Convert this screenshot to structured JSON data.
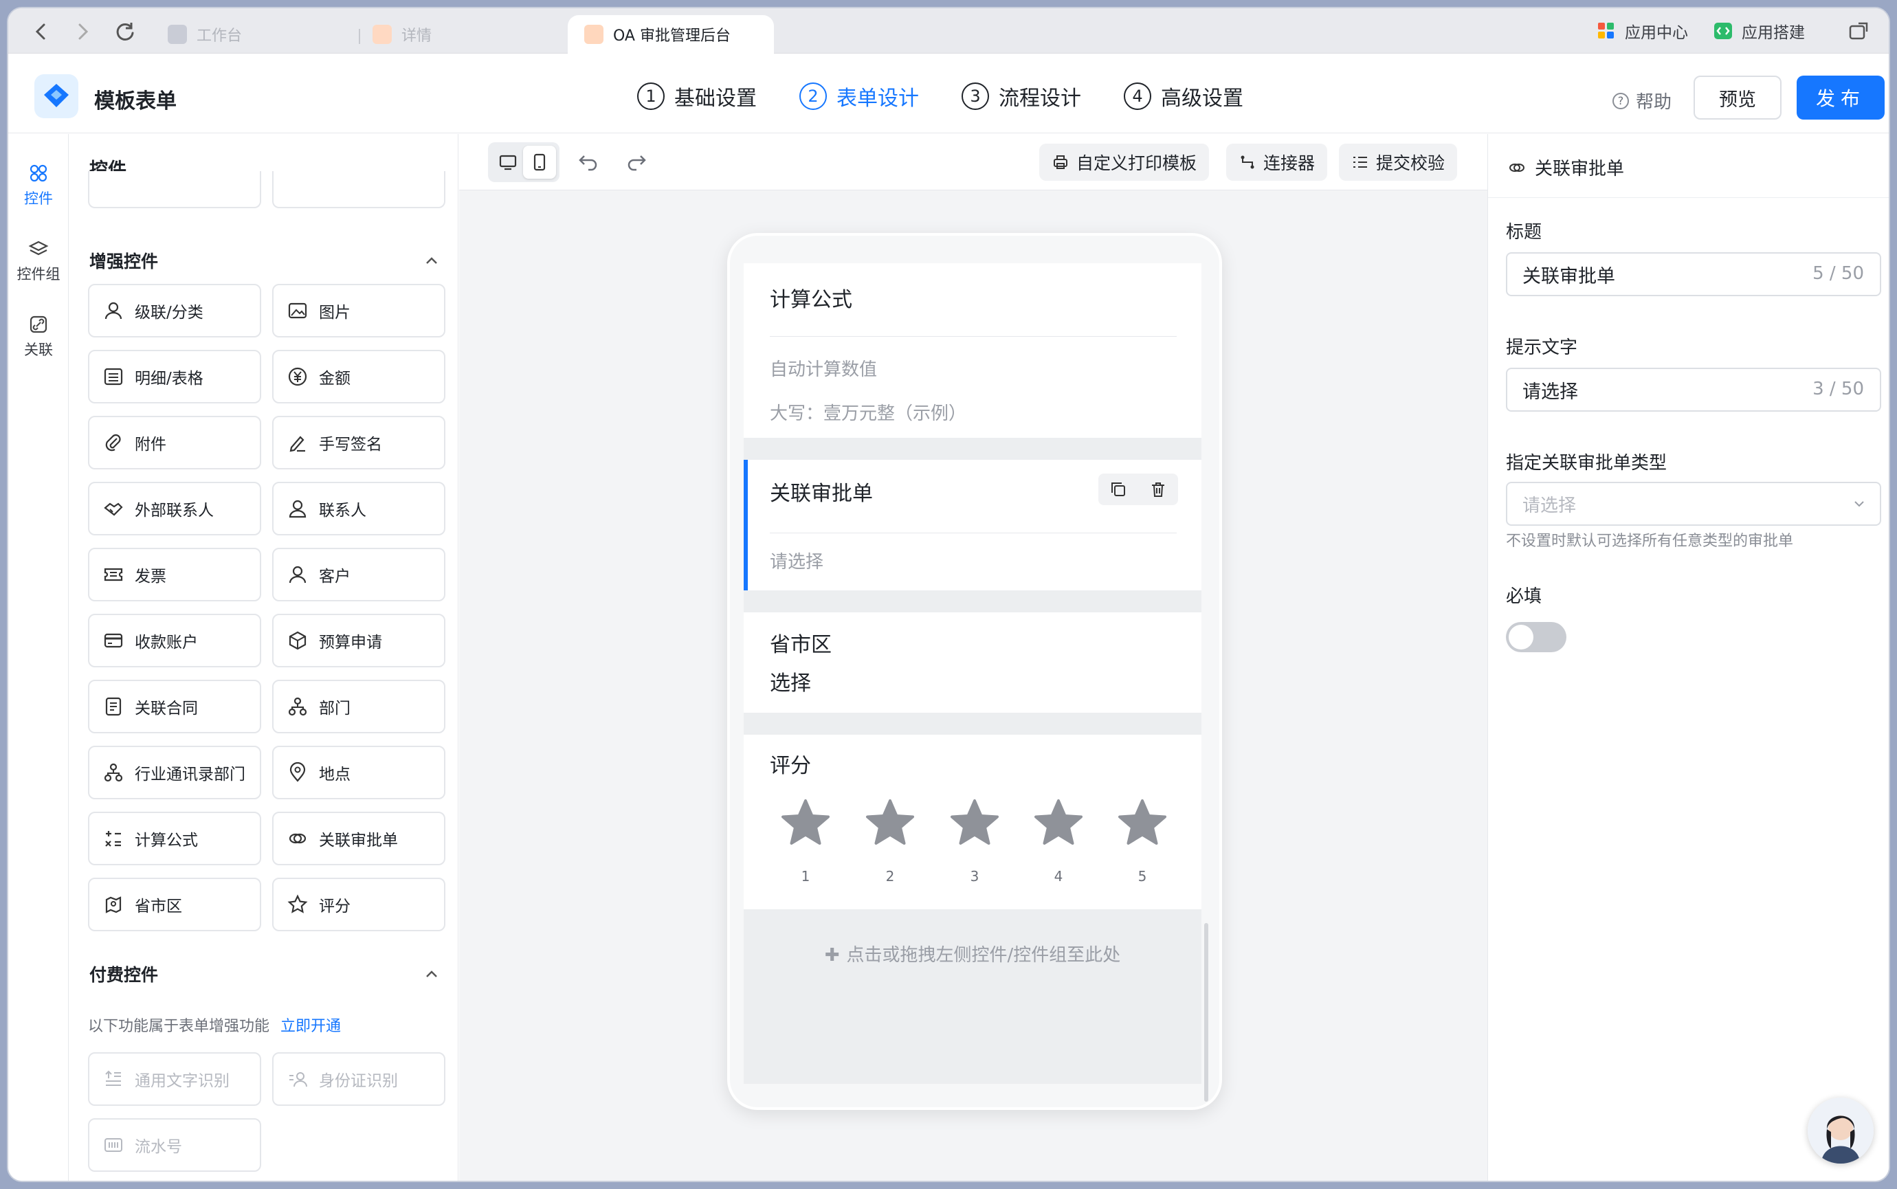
{
  "browser": {
    "tabs": [
      {
        "label": "工作台"
      },
      {
        "label": "详情"
      },
      {
        "label": "OA 审批管理后台"
      }
    ],
    "right": {
      "app_center": "应用中心",
      "app_builder": "应用搭建"
    }
  },
  "header": {
    "app_title": "模板表单",
    "steps": [
      {
        "num": "1",
        "label": "基础设置"
      },
      {
        "num": "2",
        "label": "表单设计"
      },
      {
        "num": "3",
        "label": "流程设计"
      },
      {
        "num": "4",
        "label": "高级设置"
      }
    ],
    "active_step": 2,
    "help": "帮助",
    "preview": "预览",
    "publish": "发布"
  },
  "rail": {
    "items": [
      {
        "label": "控件",
        "icon": "grid-icon"
      },
      {
        "label": "控件组",
        "icon": "layers-icon"
      },
      {
        "label": "关联",
        "icon": "link-icon"
      }
    ]
  },
  "panel": {
    "title": "控件",
    "enhanced_title": "增强控件",
    "enhanced": [
      {
        "label": "级联/分类",
        "icon": "user-icon"
      },
      {
        "label": "图片",
        "icon": "image-icon"
      },
      {
        "label": "明细/表格",
        "icon": "table-icon"
      },
      {
        "label": "金额",
        "icon": "yen-icon"
      },
      {
        "label": "附件",
        "icon": "paperclip-icon"
      },
      {
        "label": "手写签名",
        "icon": "pen-icon"
      },
      {
        "label": "外部联系人",
        "icon": "handshake-icon"
      },
      {
        "label": "联系人",
        "icon": "contact-icon"
      },
      {
        "label": "发票",
        "icon": "invoice-icon"
      },
      {
        "label": "客户",
        "icon": "customer-icon"
      },
      {
        "label": "收款账户",
        "icon": "card-icon"
      },
      {
        "label": "预算申请",
        "icon": "box-icon"
      },
      {
        "label": "关联合同",
        "icon": "contract-icon"
      },
      {
        "label": "部门",
        "icon": "org-icon"
      },
      {
        "label": "行业通讯录部门",
        "icon": "org-icon"
      },
      {
        "label": "地点",
        "icon": "location-icon"
      },
      {
        "label": "计算公式",
        "icon": "formula-icon"
      },
      {
        "label": "关联审批单",
        "icon": "link-approval-icon"
      },
      {
        "label": "省市区",
        "icon": "map-icon"
      },
      {
        "label": "评分",
        "icon": "star-icon"
      }
    ],
    "paid_title": "付费控件",
    "paid_desc": "以下功能属于表单增强功能",
    "paid_link": "立即开通",
    "paid": [
      {
        "label": "通用文字识别",
        "icon": "ocr-icon"
      },
      {
        "label": "身份证识别",
        "icon": "id-card-icon"
      },
      {
        "label": "流水号",
        "icon": "serial-icon"
      }
    ]
  },
  "toolbar": {
    "print": "自定义打印模板",
    "connector": "连接器",
    "validate": "提交校验"
  },
  "form": {
    "formula": {
      "label": "计算公式",
      "hint": "自动计算数值",
      "upper": "大写：壹万元整（示例）"
    },
    "approval": {
      "label": "关联审批单",
      "hint": "请选择"
    },
    "region": {
      "label": "省市区",
      "value": "选择"
    },
    "rating": {
      "label": "评分",
      "stars": [
        "1",
        "2",
        "3",
        "4",
        "5"
      ]
    },
    "dropzone": "点击或拖拽左侧控件/控件组至此处"
  },
  "settings": {
    "title": "关联审批单",
    "field_title_label": "标题",
    "field_title_value": "关联审批单",
    "field_title_count": "5 / 50",
    "field_hint_label": "提示文字",
    "field_hint_value": "请选择",
    "field_hint_count": "3 / 50",
    "type_label": "指定关联审批单类型",
    "type_placeholder": "请选择",
    "type_help": "不设置时默认可选择所有任意类型的审批单",
    "required_label": "必填",
    "required": false
  },
  "colors": {
    "accent": "#1677ff",
    "text": "#1f2329",
    "muted": "#9a9ea6"
  }
}
